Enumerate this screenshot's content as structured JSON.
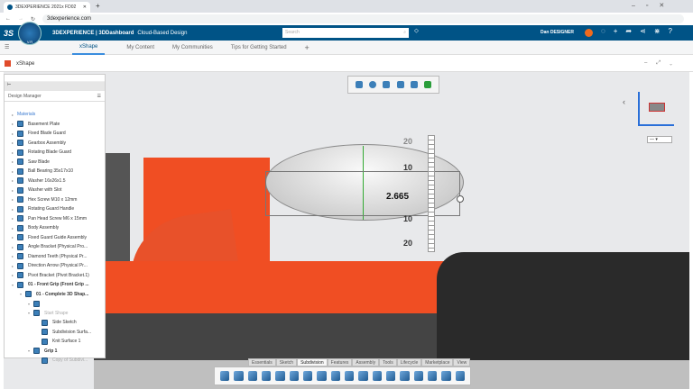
{
  "browser": {
    "tab_title": "3DEXPERIENCE 2021x FD02",
    "url": "3dexperience.com"
  },
  "header": {
    "brand": "3DEXPERIENCE | 3DDashboard",
    "dashboard": "Cloud-Based Design",
    "search_placeholder": "Search",
    "user": "Dan DESIGNER",
    "compass_version": "V.R"
  },
  "nav": {
    "tabs": [
      "xShape",
      "My Content",
      "My Communities",
      "Tips for Getting Started"
    ],
    "active": "xShape"
  },
  "app": {
    "title": "xShape"
  },
  "design_manager": {
    "title": "Design Manager",
    "items": [
      {
        "label": "Materials",
        "level": 1
      },
      {
        "label": "Basement Plate",
        "level": 1
      },
      {
        "label": "Fixed Blade Guard",
        "level": 1
      },
      {
        "label": "Gearbox Assembly",
        "level": 1
      },
      {
        "label": "Rotating Blade Guard",
        "level": 1
      },
      {
        "label": "Saw Blade",
        "level": 1
      },
      {
        "label": "Ball Bearing 35x17x10",
        "level": 1
      },
      {
        "label": "Washer 16x26x1.5",
        "level": 1
      },
      {
        "label": "Washer with Slot",
        "level": 1
      },
      {
        "label": "Hex Screw M10 x 12mm",
        "level": 1
      },
      {
        "label": "Rotating Guard Handle",
        "level": 1
      },
      {
        "label": "Pan Head Screw M6 x 15mm",
        "level": 1
      },
      {
        "label": "Body Assembly",
        "level": 1
      },
      {
        "label": "Fixed Guard Guide Assembly",
        "level": 1
      },
      {
        "label": "Angle Bracket (Physical Pro...",
        "level": 1
      },
      {
        "label": "Diamond Teeth (Physical Pr...",
        "level": 1
      },
      {
        "label": "Direction Arrow (Physical Pr...",
        "level": 1
      },
      {
        "label": "Pivot Bracket (Pivot Bracket.1)",
        "level": 1
      },
      {
        "label": "01 - Front Grip (Front Grip ...",
        "level": 1
      },
      {
        "label": "01 - Complete 3D Shap...",
        "level": 2
      },
      {
        "label": "",
        "level": 3
      },
      {
        "label": "Start Shape",
        "level": 3
      },
      {
        "label": "Side Sketch",
        "level": 4
      },
      {
        "label": "Subdivision Surfa...",
        "level": 4
      },
      {
        "label": "Knit Surface 1",
        "level": 4
      },
      {
        "label": "Grip 1",
        "level": 3
      },
      {
        "label": "Copy of Subdivi...",
        "level": 4
      }
    ]
  },
  "viewport": {
    "dimension": "2.665",
    "ruler_labels": [
      "20",
      "10",
      "10",
      "20"
    ],
    "view_dropdown": "—"
  },
  "bottom_tabs": [
    "Essentials",
    "Sketch",
    "Subdivision",
    "Features",
    "Assembly",
    "Tools",
    "Lifecycle",
    "Marketplace",
    "View"
  ],
  "active_bottom_tab": "Subdivision",
  "colors": {
    "header": "#005386",
    "orange": "#f04e23",
    "shape": "#e6e6e6"
  }
}
